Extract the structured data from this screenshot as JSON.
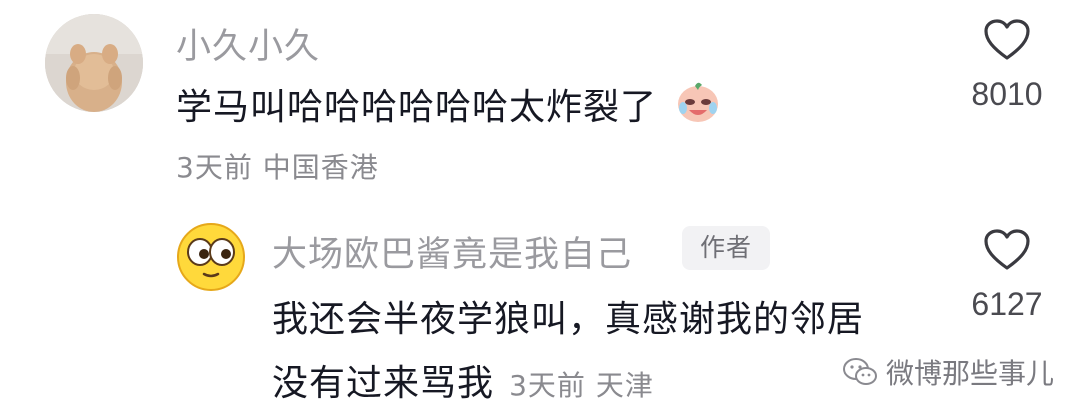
{
  "comments": [
    {
      "username": "小久小久",
      "text": "学马叫哈哈哈哈哈哈太炸裂了",
      "emoji": "crying-laugh-emoji",
      "meta": "3天前 中国香港",
      "likes": "8010",
      "avatar": "bear-doll-avatar"
    }
  ],
  "reply": {
    "username": "大场欧巴酱竟是我自己",
    "badge": "作者",
    "text_line1": "我还会半夜学狼叫，真感谢我的邻居",
    "text_line2": "没有过来骂我",
    "meta": "3天前 天津",
    "likes": "6127",
    "avatar": "googly-eyes-emoji-avatar"
  },
  "watermark": {
    "text": "微博那些事儿",
    "icon": "wechat-icon"
  },
  "colors": {
    "username": "#9a9a9f",
    "text": "#161823",
    "meta": "#8a8a8f",
    "badge_bg": "#f2f2f4"
  }
}
